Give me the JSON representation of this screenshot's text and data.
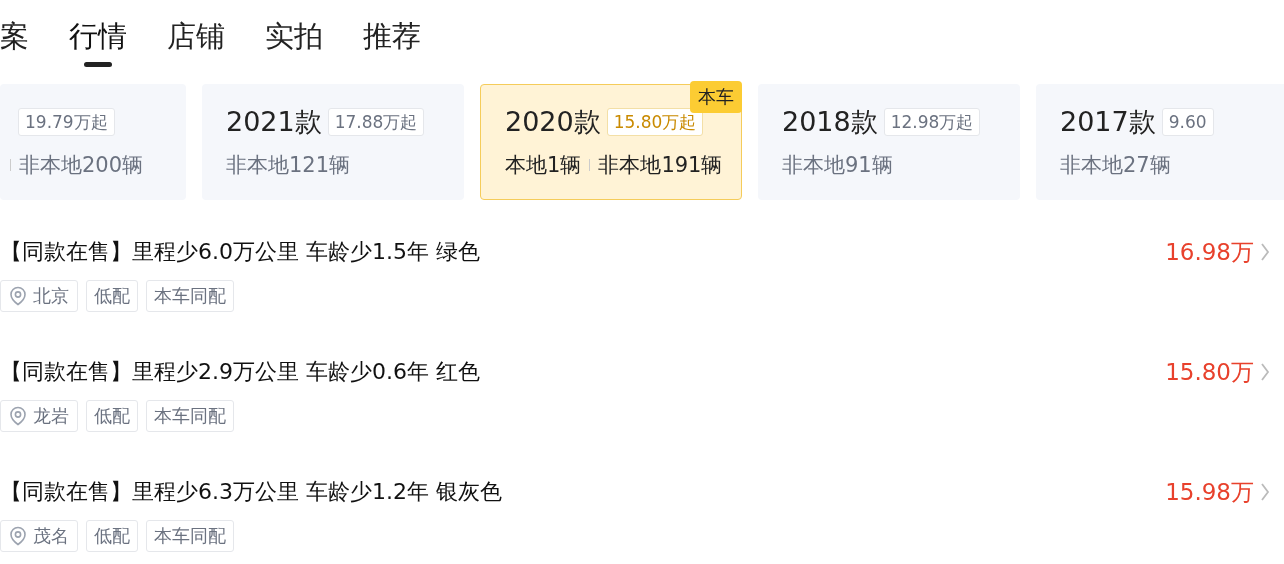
{
  "tabs": [
    {
      "label": "案",
      "selected": false
    },
    {
      "label": "行情",
      "selected": true
    },
    {
      "label": "店铺",
      "selected": false
    },
    {
      "label": "实拍",
      "selected": false
    },
    {
      "label": "推荐",
      "selected": false
    }
  ],
  "model_years": [
    {
      "price": "19.79万起",
      "nonlocal": "非本地200辆",
      "selected": false,
      "divider": true
    },
    {
      "title": "2021款",
      "price": "17.88万起",
      "nonlocal": "非本地121辆",
      "selected": false
    },
    {
      "title": "2020款",
      "price": "15.80万起",
      "local": "本地1辆",
      "nonlocal": "非本地191辆",
      "selected": true,
      "badge": "本车"
    },
    {
      "title": "2018款",
      "price": "12.98万起",
      "nonlocal": "非本地91辆",
      "selected": false
    },
    {
      "title": "2017款",
      "price": "9.60",
      "nonlocal": "非本地27辆",
      "selected": false
    }
  ],
  "listings": [
    {
      "title": "【同款在售】里程少6.0万公里 车龄少1.5年 绿色",
      "price": "16.98万",
      "location": "北京",
      "tags": [
        "低配",
        "本车同配"
      ]
    },
    {
      "title": "【同款在售】里程少2.9万公里 车龄少0.6年 红色",
      "price": "15.80万",
      "location": "龙岩",
      "tags": [
        "低配",
        "本车同配"
      ]
    },
    {
      "title": "【同款在售】里程少6.3万公里 车龄少1.2年 银灰色",
      "price": "15.98万",
      "location": "茂名",
      "tags": [
        "低配",
        "本车同配"
      ]
    }
  ]
}
